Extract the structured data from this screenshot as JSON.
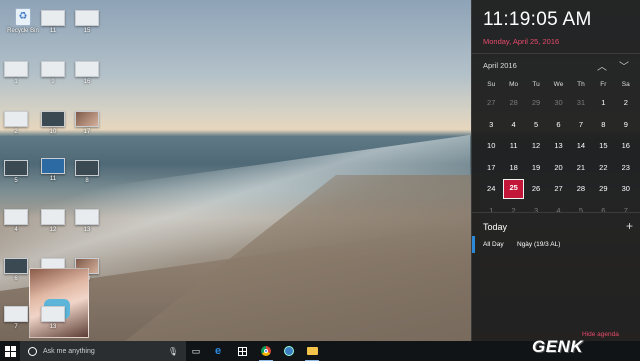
{
  "desktop": {
    "icons": [
      {
        "id": "recycle",
        "label": "Recycle Bin"
      },
      {
        "id": "i1",
        "label": "11"
      },
      {
        "id": "i2",
        "label": "15"
      },
      {
        "id": "i3",
        "label": "1"
      },
      {
        "id": "i4",
        "label": "9"
      },
      {
        "id": "i5",
        "label": "16"
      },
      {
        "id": "i6",
        "label": "2"
      },
      {
        "id": "i7",
        "label": "10"
      },
      {
        "id": "i8",
        "label": "17"
      },
      {
        "id": "i9",
        "label": "5"
      },
      {
        "id": "i10",
        "label": "11"
      },
      {
        "id": "i11",
        "label": "8"
      },
      {
        "id": "i12",
        "label": "4"
      },
      {
        "id": "i13",
        "label": "12"
      },
      {
        "id": "i14",
        "label": "13"
      },
      {
        "id": "i15",
        "label": "6"
      },
      {
        "id": "i16",
        "label": "12"
      },
      {
        "id": "i17",
        "label": "20"
      },
      {
        "id": "i18",
        "label": "7"
      },
      {
        "id": "i19",
        "label": "13"
      }
    ]
  },
  "flyout": {
    "time": "11:19:05 AM",
    "date": "Monday, April 25, 2016",
    "month": "April 2016",
    "weekdays": [
      "Su",
      "Mo",
      "Tu",
      "We",
      "Th",
      "Fr",
      "Sa"
    ],
    "weeks": [
      [
        "27",
        "28",
        "29",
        "30",
        "31",
        "1",
        "2"
      ],
      [
        "3",
        "4",
        "5",
        "6",
        "7",
        "8",
        "9"
      ],
      [
        "10",
        "11",
        "12",
        "13",
        "14",
        "15",
        "16"
      ],
      [
        "17",
        "18",
        "19",
        "20",
        "21",
        "22",
        "23"
      ],
      [
        "24",
        "25",
        "26",
        "27",
        "28",
        "29",
        "30"
      ],
      [
        "1",
        "2",
        "3",
        "4",
        "5",
        "6",
        "7"
      ]
    ],
    "today_label": "Today",
    "agenda_time": "All Day",
    "agenda_event": "Ngày (19/3 AL)",
    "hide_agenda": "Hide agenda",
    "accent_color": "#c3173a"
  },
  "taskbar": {
    "search_placeholder": "Ask me anything"
  },
  "watermark": "GENK"
}
